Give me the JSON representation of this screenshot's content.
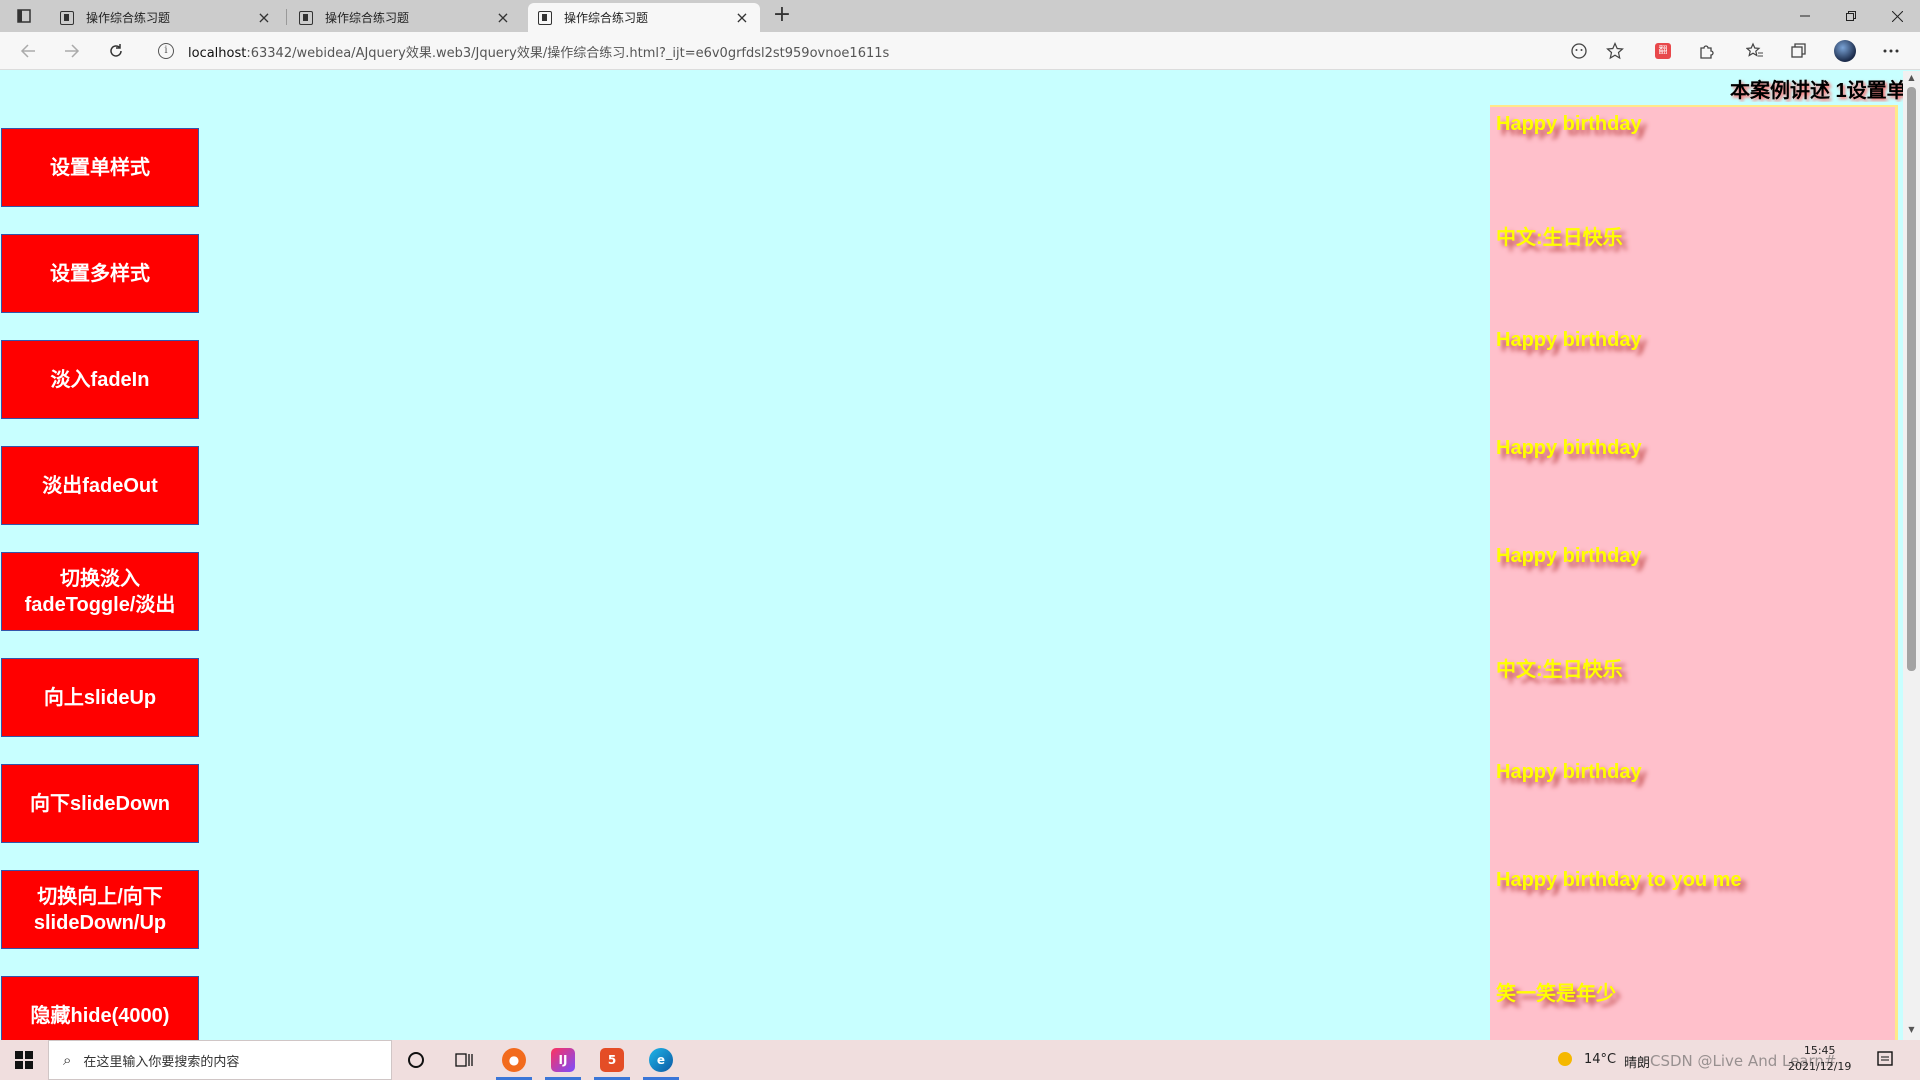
{
  "browser": {
    "tabs": [
      {
        "title": "操作综合练习题",
        "close": "×"
      },
      {
        "title": "操作综合练习题",
        "close": "×"
      },
      {
        "title": "操作综合练习题",
        "close": "×"
      }
    ],
    "new_tab": "+",
    "address": {
      "host": "localhost",
      "path": ":63342/webidea/AJquery效果.web3/Jquery效果/操作综合练习.html?_ijt=e6v0grfdsl2st959ovnoe1611s"
    },
    "icons": {
      "back": "back-arrow-icon",
      "forward": "forward-arrow-icon",
      "reload": "reload-icon",
      "info": "info-icon",
      "read_aloud": "read-aloud-icon",
      "favorite_add": "add-favorite-icon",
      "extension_red": "extension-icon",
      "extensions": "puzzle-icon",
      "favorites": "favorites-icon",
      "collections": "collections-icon",
      "profile": "profile-avatar",
      "menu": "more-icon"
    }
  },
  "page": {
    "marquee": "本案例讲述  1设置单",
    "buttons": [
      {
        "line1": "设置单样式",
        "line2": ""
      },
      {
        "line1": "设置多样式",
        "line2": ""
      },
      {
        "line1": "淡入fadeIn",
        "line2": ""
      },
      {
        "line1": "淡出fadeOut",
        "line2": ""
      },
      {
        "line1": "切换淡入",
        "line2": "fadeToggle/淡出"
      },
      {
        "line1": "向上slideUp",
        "line2": ""
      },
      {
        "line1": "向下slideDown",
        "line2": ""
      },
      {
        "line1": "切换向上/向下",
        "line2": "slideDown/Up"
      },
      {
        "line1": "隐藏hide(4000)",
        "line2": ""
      }
    ],
    "birthday_lines": [
      "Happy birthday",
      "中文:生日快乐",
      "Happy birthday",
      "Happy birthday",
      "Happy birthday",
      "中文:生日快乐",
      "Happy birthday",
      "Happy birthday to you me",
      "笑一笑是年少"
    ],
    "colors": {
      "background": "#c8ffff",
      "button": "#ff0000",
      "birthday_box": "#ffc0cb",
      "birthday_text": "#ffff00"
    }
  },
  "taskbar": {
    "search_placeholder": "在这里输入你要搜索的内容",
    "weather_temp": "14°C",
    "weather_desc": "晴朗",
    "time": "15:45",
    "date": "2021/12/19",
    "watermark": "CSDN @Live And Learn#"
  }
}
